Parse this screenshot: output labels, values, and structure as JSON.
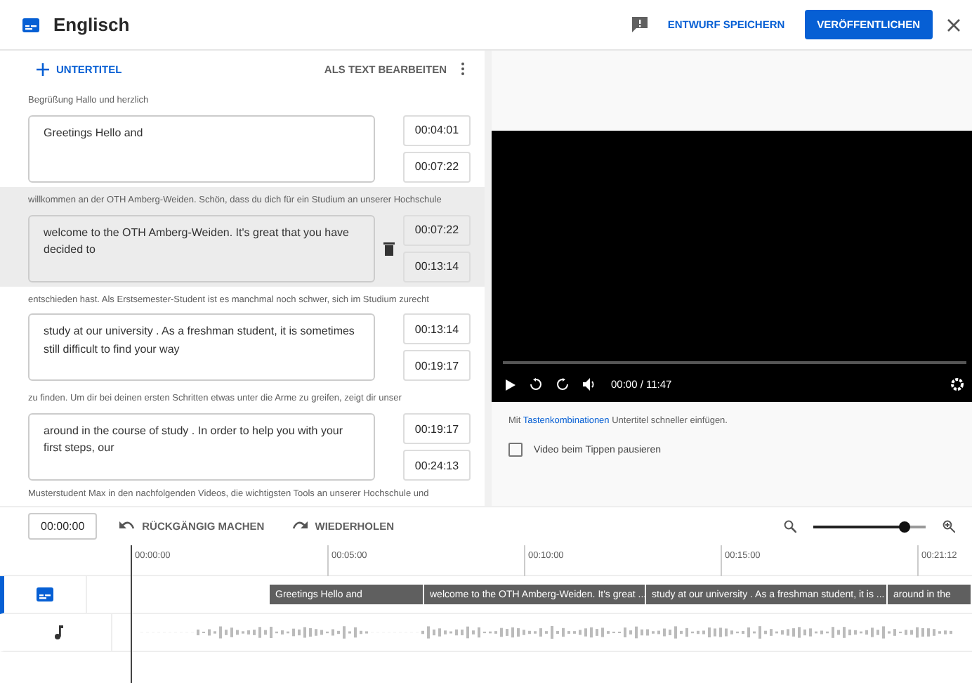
{
  "header": {
    "title": "Englisch",
    "save_label": "ENTWURF SPEICHERN",
    "publish_label": "VERÖFFENTLICHEN"
  },
  "editor": {
    "add_label": "UNTERTITEL",
    "edit_as_text_label": "ALS TEXT BEARBEITEN",
    "cues": [
      {
        "source": "Begrüßung Hallo und herzlich",
        "text": "Greetings Hello and",
        "start": "00:04:01",
        "end": "00:07:22",
        "selected": false
      },
      {
        "source": "willkommen an der OTH Amberg-Weiden. Schön, dass  du dich für ein Studium an unserer Hochschule",
        "text": "welcome to the OTH Amberg-Weiden. It's great that you have decided to",
        "start": "00:07:22",
        "end": "00:13:14",
        "selected": true
      },
      {
        "source": "entschieden hast. Als Erstsemester-Student ist  es manchmal noch schwer, sich im Studium zurecht",
        "text": "study at our university . As a freshman student, it is sometimes still difficult to find your way",
        "start": "00:13:14",
        "end": "00:19:17",
        "selected": false
      },
      {
        "source": "zu finden. Um dir bei deinen ersten Schritten  etwas unter die Arme zu greifen, zeigt dir unser",
        "text": "around in the course of study . In order to help you with your first steps, our",
        "start": "00:19:17",
        "end": "00:24:13",
        "selected": false
      }
    ],
    "trailing_source": "Musterstudent Max in den nachfolgenden Videos,  die wichtigsten Tools an unserer Hochschule und"
  },
  "player": {
    "time": "00:00 / 11:47",
    "hint_prefix": "Mit ",
    "hint_link": "Tastenkombinationen",
    "hint_suffix": " Untertitel schneller einfügen.",
    "pause_option": {
      "label": "Video beim Tippen pausieren",
      "checked": false
    }
  },
  "timeline": {
    "timecode": "00:00:00",
    "undo_label": "RÜCKGÄNGIG MACHEN",
    "redo_label": "WIEDERHOLEN",
    "ticks": [
      "00:00:00",
      "00:05:00",
      "00:10:00",
      "00:15:00",
      "00:21:12"
    ],
    "segments": [
      "Greetings Hello and",
      "welcome to the OTH Amberg-Weiden. It's great ...",
      "study at our university . As a freshman student, it is ...",
      "around in the"
    ]
  }
}
